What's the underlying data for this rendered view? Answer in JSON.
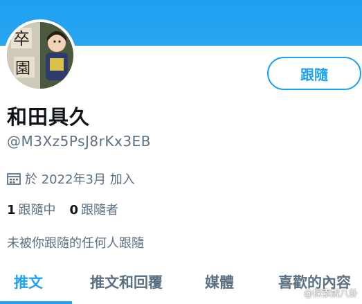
{
  "profile": {
    "follow_label": "跟隨",
    "display_name": "和田具久",
    "handle": "@M3Xz5PsJ8rKx3EB",
    "joined": "於 2022年3月 加入",
    "following_count": "1",
    "following_label": "跟隨中",
    "followers_count": "0",
    "followers_label": "跟隨者",
    "not_followed_text": "未被你跟隨的任何人跟隨"
  },
  "tabs": [
    {
      "label": "推文",
      "active": true
    },
    {
      "label": "推文和回覆",
      "active": false
    },
    {
      "label": "媒體",
      "active": false
    },
    {
      "label": "喜歡的內容",
      "active": false
    }
  ],
  "watermark": "@探索說八卦",
  "colors": {
    "accent": "#1da1f2",
    "secondary_text": "#5b7083",
    "primary_text": "#0f1419"
  }
}
